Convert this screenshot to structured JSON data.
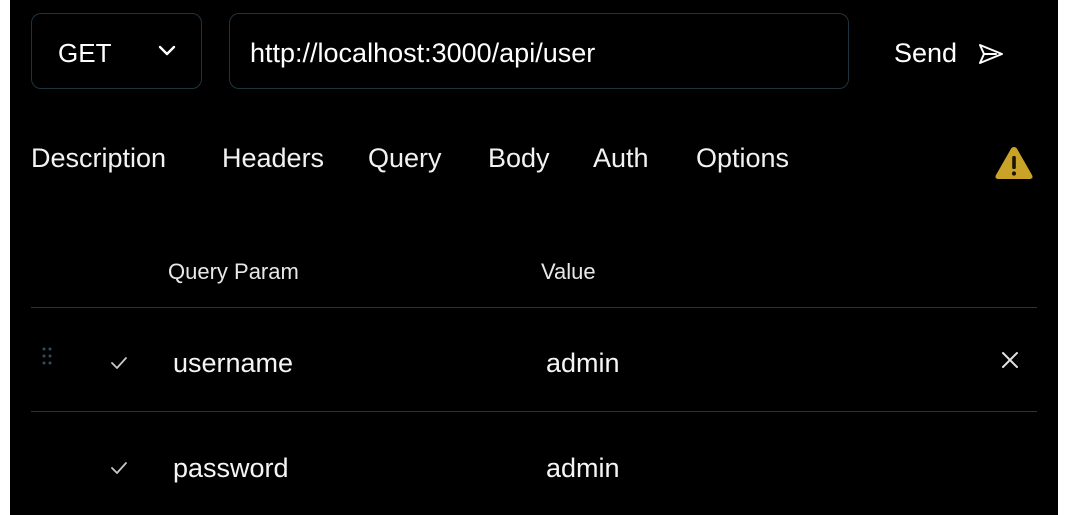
{
  "request": {
    "method": "GET",
    "url": "http://localhost:3000/api/user",
    "send_label": "Send"
  },
  "tabs": [
    {
      "label": "Description"
    },
    {
      "label": "Headers"
    },
    {
      "label": "Query"
    },
    {
      "label": "Body"
    },
    {
      "label": "Auth"
    },
    {
      "label": "Options"
    }
  ],
  "table": {
    "headers": {
      "param": "Query Param",
      "value": "Value"
    },
    "rows": [
      {
        "param": "username",
        "value": "admin",
        "enabled": true
      },
      {
        "param": "password",
        "value": "admin",
        "enabled": true
      }
    ]
  },
  "icons": {
    "method_dropdown": "chevron-down-icon",
    "send": "send-arrow-icon",
    "warning": "warning-icon",
    "row_check": "check-icon",
    "drag": "drag-handle-icon",
    "remove": "close-icon"
  },
  "colors": {
    "background": "#000000",
    "border": "#1f3340",
    "divider": "#203645",
    "warning": "#c9a227"
  }
}
